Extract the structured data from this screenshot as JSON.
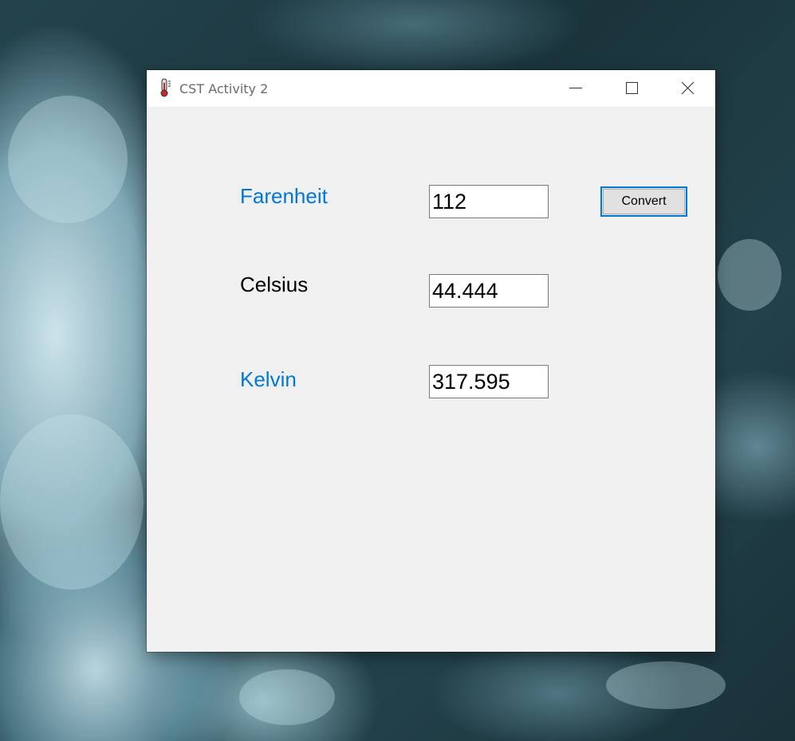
{
  "window": {
    "title": "CST Activity 2",
    "icon": "thermometer-icon"
  },
  "caption_buttons": {
    "minimize_icon": "minimize-icon",
    "maximize_icon": "maximize-icon",
    "close_icon": "close-icon"
  },
  "form": {
    "fahrenheit_label": "Farenheit",
    "fahrenheit_value": "112",
    "celsius_label": "Celsius",
    "celsius_value": "44.444",
    "kelvin_label": "Kelvin",
    "kelvin_value": "317.595",
    "convert_label": "Convert"
  },
  "colors": {
    "fahrenheit_label": "#0078d7",
    "celsius_label": "#000000",
    "kelvin_label": "#0078d7",
    "button_focus_border": "#0078d7",
    "window_background": "#f0f0f0"
  }
}
